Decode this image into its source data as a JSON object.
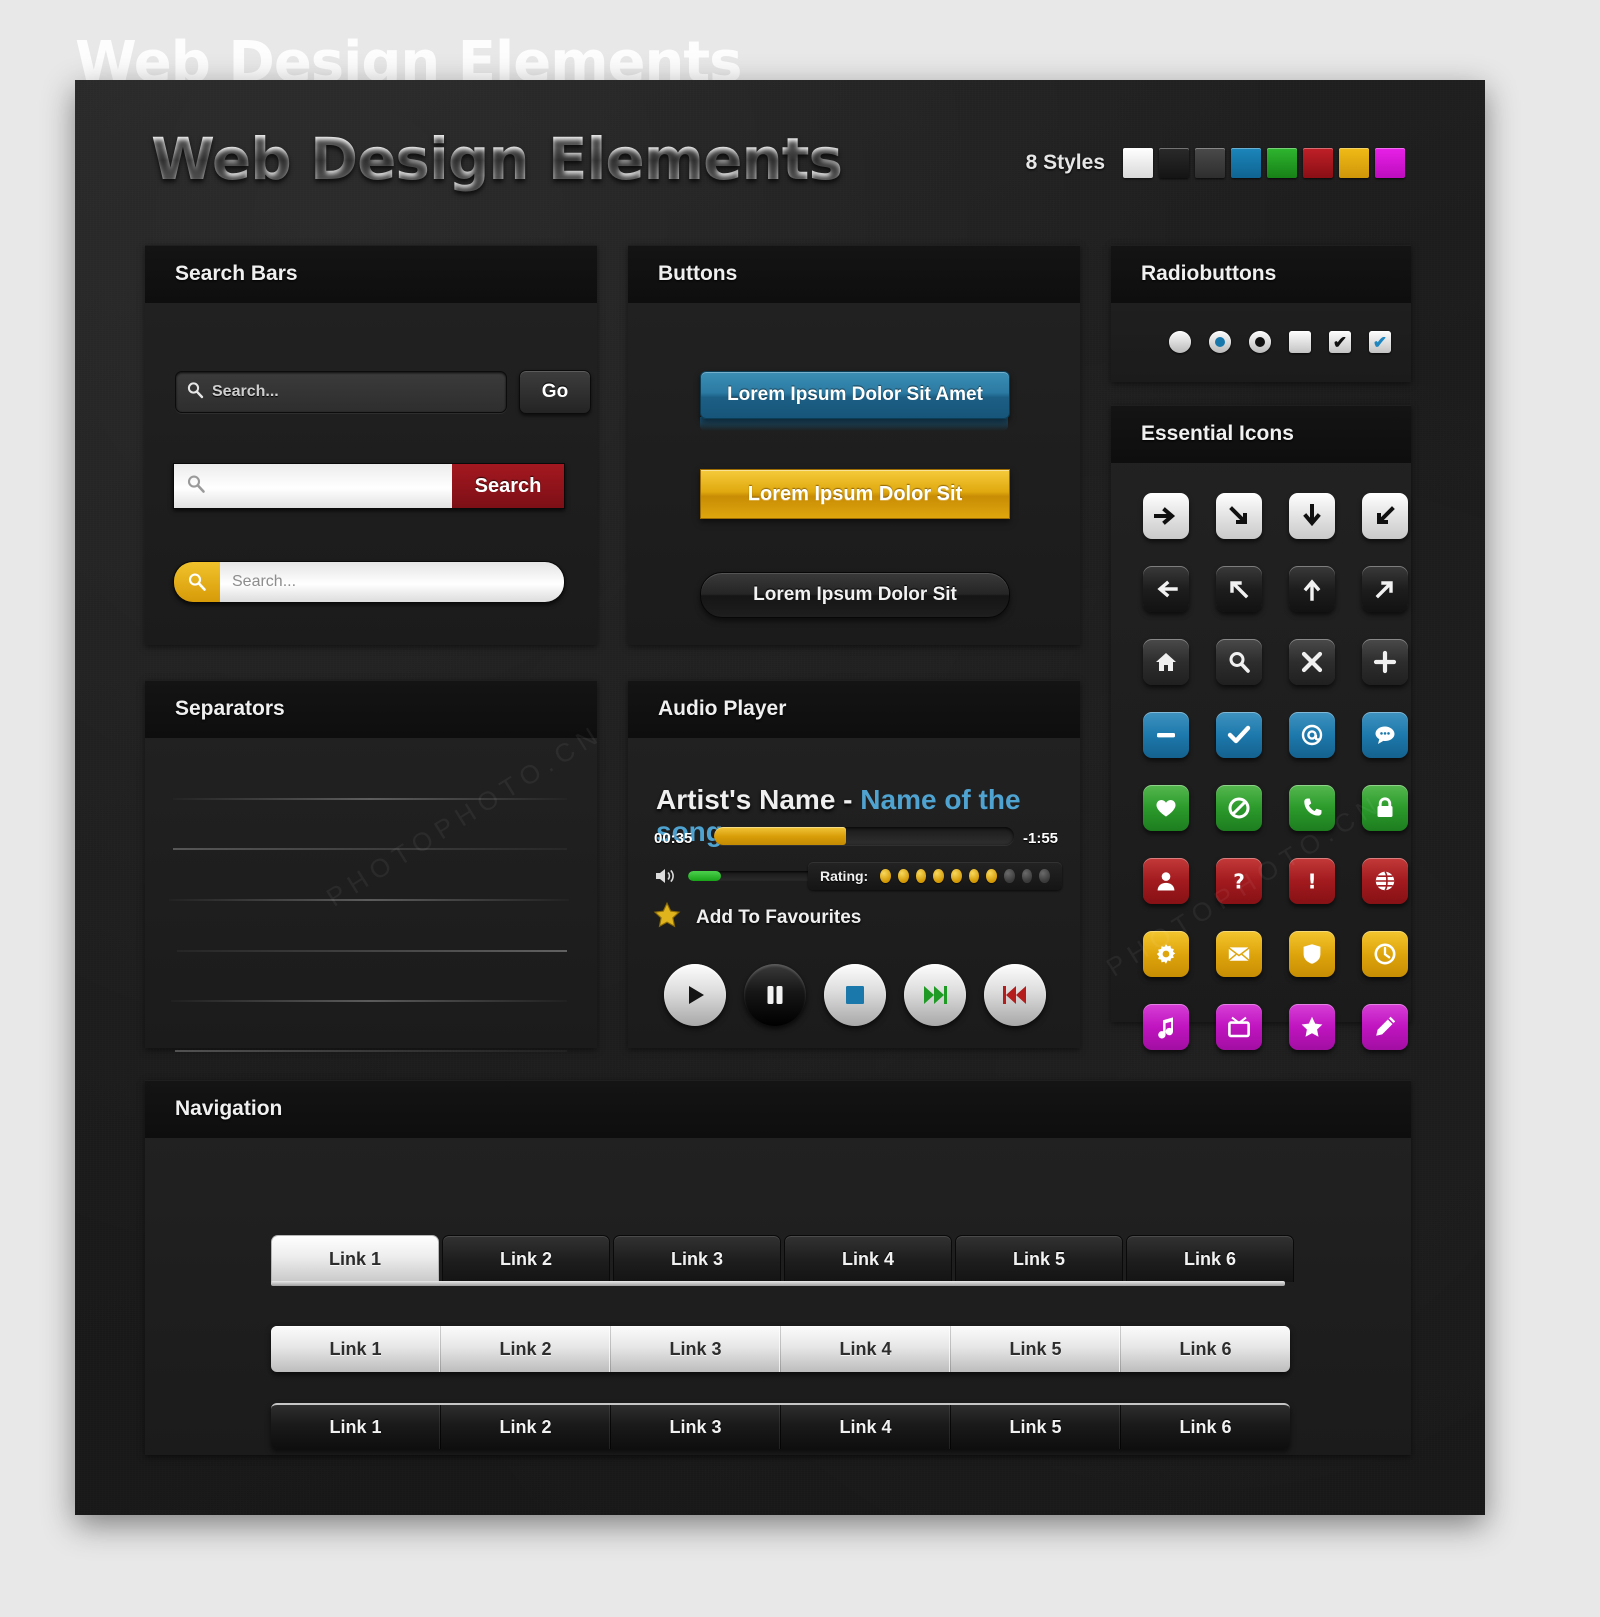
{
  "header": {
    "title": "Web Design Elements",
    "styles_label": "8 Styles",
    "swatches": [
      "#f2f2f2",
      "#1e1e1e",
      "#3a3a3a",
      "#1478a8",
      "#23a023",
      "#b01820",
      "#e0a80e",
      "#d818d8"
    ]
  },
  "search_bars": {
    "panel_title": "Search Bars",
    "bar1": {
      "placeholder": "Search...",
      "button": "Go",
      "icon": "magnifier-icon"
    },
    "bar2": {
      "placeholder": "",
      "button": "Search",
      "icon": "magnifier-icon",
      "button_color": "#8d1219"
    },
    "bar3": {
      "placeholder": "Search...",
      "icon": "magnifier-icon",
      "icon_bg": "#dca40b"
    }
  },
  "buttons": {
    "panel_title": "Buttons",
    "items": [
      {
        "label": "Lorem Ipsum Dolor Sit Amet",
        "style": "blue"
      },
      {
        "label": "Lorem Ipsum Dolor Sit",
        "style": "gold"
      },
      {
        "label": "Lorem Ipsum Dolor Sit",
        "style": "dark"
      }
    ]
  },
  "radiobuttons": {
    "panel_title": "Radiobuttons",
    "controls": [
      {
        "name": "radio-unchecked",
        "type": "circle",
        "state": "empty"
      },
      {
        "name": "radio-checked-blue",
        "type": "circle",
        "state": "blue"
      },
      {
        "name": "radio-checked-black",
        "type": "circle",
        "state": "black"
      },
      {
        "name": "checkbox-unchecked",
        "type": "square",
        "state": "empty"
      },
      {
        "name": "checkbox-checked-black",
        "type": "square",
        "state": "black"
      },
      {
        "name": "checkbox-checked-blue",
        "type": "square",
        "state": "blue"
      }
    ]
  },
  "essential_icons": {
    "panel_title": "Essential Icons",
    "items": [
      {
        "name": "arrow-right-icon",
        "tone": "light"
      },
      {
        "name": "arrow-down-right-icon",
        "tone": "light"
      },
      {
        "name": "arrow-down-icon",
        "tone": "light"
      },
      {
        "name": "arrow-down-left-icon",
        "tone": "light"
      },
      {
        "name": "arrow-left-icon",
        "tone": "black"
      },
      {
        "name": "arrow-up-left-icon",
        "tone": "black"
      },
      {
        "name": "arrow-up-icon",
        "tone": "black"
      },
      {
        "name": "arrow-up-right-icon",
        "tone": "black"
      },
      {
        "name": "home-icon",
        "tone": "gray"
      },
      {
        "name": "search-icon",
        "tone": "gray"
      },
      {
        "name": "close-icon",
        "tone": "gray"
      },
      {
        "name": "plus-icon",
        "tone": "gray"
      },
      {
        "name": "minus-icon",
        "tone": "blue"
      },
      {
        "name": "check-icon",
        "tone": "blue"
      },
      {
        "name": "at-icon",
        "tone": "blue"
      },
      {
        "name": "chat-icon",
        "tone": "blue"
      },
      {
        "name": "heart-icon",
        "tone": "green"
      },
      {
        "name": "block-icon",
        "tone": "green"
      },
      {
        "name": "phone-icon",
        "tone": "green"
      },
      {
        "name": "lock-icon",
        "tone": "green"
      },
      {
        "name": "user-icon",
        "tone": "red"
      },
      {
        "name": "question-icon",
        "tone": "red"
      },
      {
        "name": "exclamation-icon",
        "tone": "red"
      },
      {
        "name": "globe-icon",
        "tone": "red"
      },
      {
        "name": "gear-icon",
        "tone": "gold"
      },
      {
        "name": "mail-icon",
        "tone": "gold"
      },
      {
        "name": "shield-icon",
        "tone": "gold"
      },
      {
        "name": "clock-icon",
        "tone": "gold"
      },
      {
        "name": "music-icon",
        "tone": "magenta"
      },
      {
        "name": "tv-icon",
        "tone": "magenta"
      },
      {
        "name": "star-icon",
        "tone": "magenta"
      },
      {
        "name": "pencil-icon",
        "tone": "magenta"
      }
    ]
  },
  "separators": {
    "panel_title": "Separators",
    "count": 6
  },
  "audio_player": {
    "panel_title": "Audio Player",
    "artist": "Artist's Name -",
    "song": "Name of the song",
    "elapsed": "00:35",
    "remaining": "-1:55",
    "progress_percent": 44,
    "volume_percent": 26,
    "rating_label": "Rating:",
    "rating_filled": 7,
    "rating_total": 10,
    "favourites_label": "Add To Favourites",
    "controls": [
      {
        "name": "play-button",
        "style": "silver"
      },
      {
        "name": "pause-button",
        "style": "dark"
      },
      {
        "name": "stop-button",
        "style": "silver"
      },
      {
        "name": "next-button",
        "style": "silver"
      },
      {
        "name": "previous-button",
        "style": "silver"
      }
    ]
  },
  "navigation": {
    "panel_title": "Navigation",
    "links": [
      "Link 1",
      "Link 2",
      "Link 3",
      "Link 4",
      "Link 5",
      "Link 6"
    ],
    "active_index": 0
  },
  "watermarks": [
    "PHOTOPHOTO.CN",
    "PHOTOPHOTO.CN"
  ]
}
